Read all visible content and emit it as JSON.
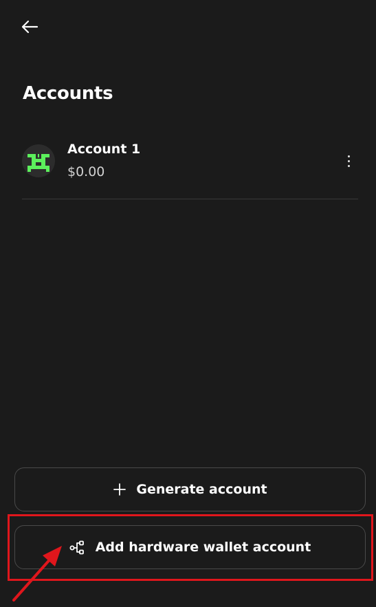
{
  "header": {
    "back_icon": "arrow-left-icon",
    "title": "Accounts"
  },
  "accounts": [
    {
      "name": "Account 1",
      "balance": "$0.00",
      "avatar_icon": "pixel-avatar-icon",
      "avatar_color": "#5cf05c",
      "menu_icon": "more-vertical-icon"
    }
  ],
  "actions": {
    "generate": {
      "label": "Generate account",
      "icon": "plus-icon"
    },
    "hardware": {
      "label": "Add hardware wallet account",
      "icon": "hardware-wallet-icon"
    }
  },
  "annotation": {
    "highlight_color": "#e0161c"
  }
}
